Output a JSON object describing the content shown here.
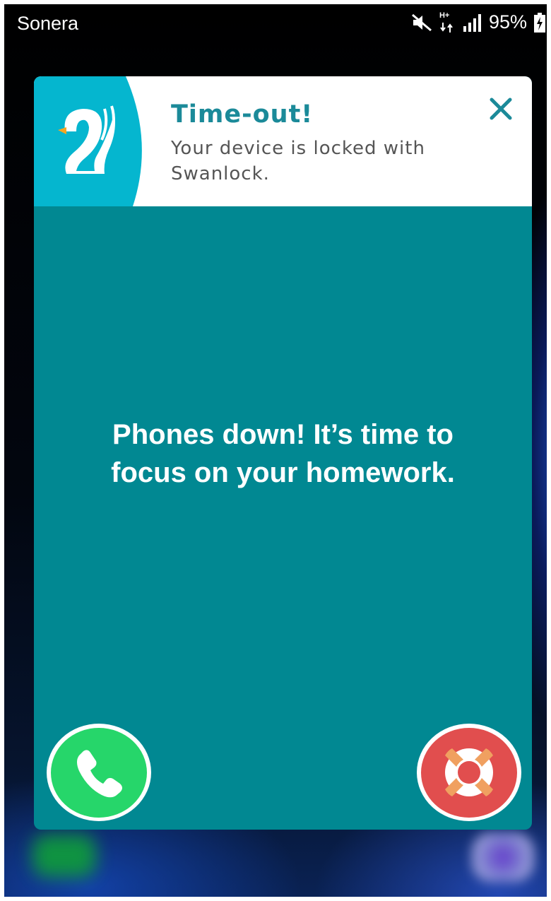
{
  "status_bar": {
    "carrier": "Sonera",
    "network_type": "H+",
    "battery_percent": "95%",
    "icons": [
      "mute-icon",
      "data-arrows-icon",
      "signal-icon",
      "battery-charging-icon"
    ]
  },
  "dialog": {
    "title": "Time-out!",
    "message": "Your device is locked with Swanlock.",
    "close_icon": "close-icon",
    "logo_icon": "swanlock-logo-icon",
    "focus_message": "Phones down! It’s time to focus on your homework.",
    "call_button_icon": "phone-icon",
    "help_button_icon": "lifebuoy-icon"
  },
  "colors": {
    "dialog_bg": "#018892",
    "title": "#1b8a99",
    "logo_tile": "#05b6cf",
    "call_green": "#26d66a",
    "help_red": "#e14e4e",
    "lifebuoy_orange": "#f0a060"
  }
}
